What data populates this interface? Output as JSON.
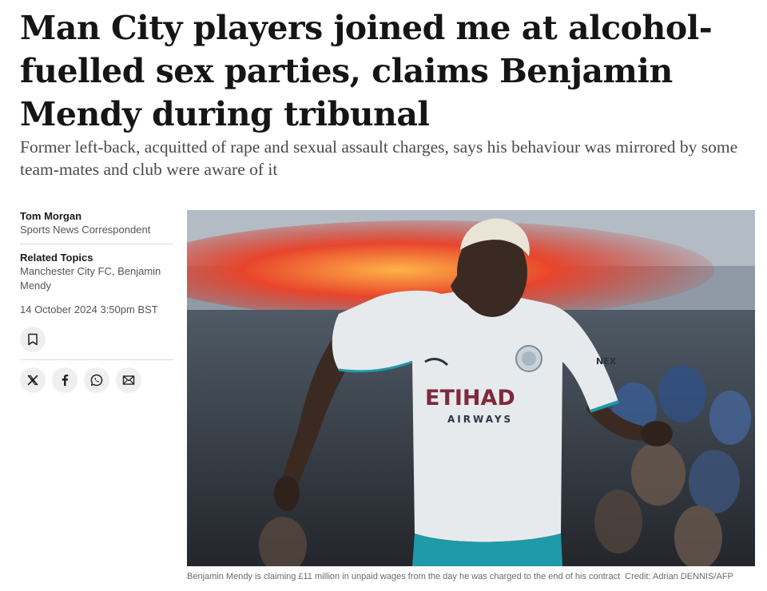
{
  "article": {
    "headline": "Man City players joined me at alcohol-fuelled sex parties, claims Benjamin Mendy during tribunal",
    "standfirst": "Former left-back, acquitted of rape and sexual assault charges, says his behaviour was mirrored by some team-mates and club were aware of it"
  },
  "byline": {
    "author": "Tom Morgan",
    "role": "Sports News Correspondent"
  },
  "related": {
    "heading": "Related Topics",
    "topics": "Manchester City FC, Benjamin Mendy"
  },
  "published": "14 October 2024 3:50pm BST",
  "actions": {
    "bookmark_icon": "bookmark-icon",
    "share_icons": [
      "x-icon",
      "facebook-icon",
      "whatsapp-icon",
      "email-icon"
    ]
  },
  "image": {
    "shirt_sponsor": "ETIHAD",
    "shirt_sponsor_sub": "AIRWAYS",
    "sleeve_text": "NEX",
    "caption": "Benjamin Mendy is claiming £11 million in unpaid wages from the day he was charged to the end of his contract",
    "credit": "Credit: Adrian DENNIS/AFP"
  },
  "colors": {
    "headline": "#151515",
    "standfirst": "#4a4a4a",
    "meta": "#555555",
    "icon_bg": "#efefef",
    "kit_teal": "#1f9aa8"
  }
}
